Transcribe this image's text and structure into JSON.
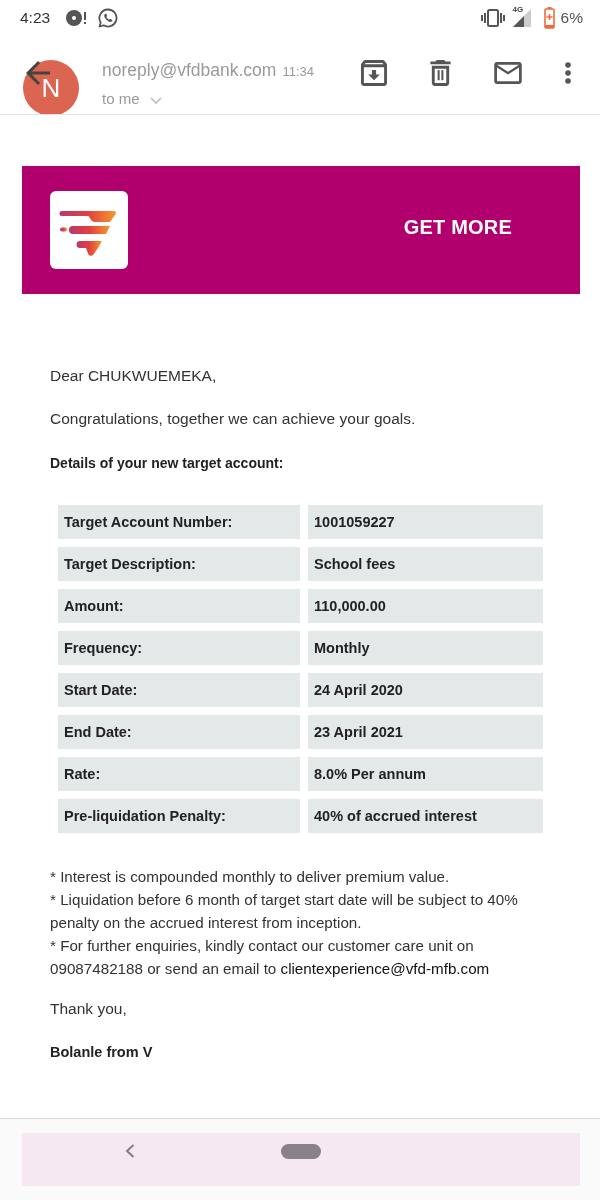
{
  "status_bar": {
    "time": "4:23",
    "network": "4G",
    "battery": "6%"
  },
  "sender": {
    "initial": "N",
    "address": "noreply@vfdbank.com",
    "time": "11:34",
    "recipient": "to me"
  },
  "banner": {
    "title": "GET MORE"
  },
  "message": {
    "greeting": "Dear CHUKWUEMEKA,",
    "intro": "Congratulations, together we can achieve your goals.",
    "details_heading": "Details of your new target account:",
    "details": [
      {
        "label": "Target Account Number:",
        "value": "1001059227"
      },
      {
        "label": "Target Description:",
        "value": "School fees"
      },
      {
        "label": "Amount:",
        "value": "110,000.00"
      },
      {
        "label": "Frequency:",
        "value": "Monthly"
      },
      {
        "label": "Start Date:",
        "value": "24 April 2020"
      },
      {
        "label": "End Date:",
        "value": "23 April 2021"
      },
      {
        "label": "Rate:",
        "value": "8.0% Per annum"
      },
      {
        "label": "Pre-liquidation Penalty:",
        "value": "40% of accrued interest"
      }
    ],
    "notes": [
      {
        "text": "* Interest is compounded monthly to deliver premium value."
      },
      {
        "text": "* Liquidation before 6 month of target start date will be subject to 40% penalty on the accrued interest from inception."
      },
      {
        "text": "* For further enquiries, kindly contact our customer care unit on 09087482188 or send an email to",
        "link": "clientexperience@vfd-mfb.com"
      }
    ],
    "closing": "Thank you,",
    "signature": "Bolanle from V"
  }
}
